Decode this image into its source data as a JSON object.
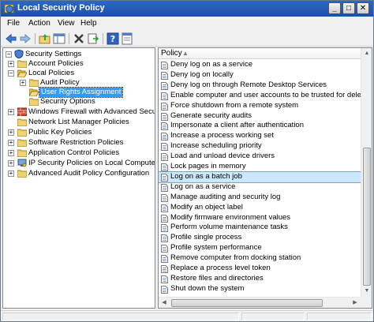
{
  "window": {
    "title": "Local Security Policy"
  },
  "menu": [
    "File",
    "Action",
    "View",
    "Help"
  ],
  "window_buttons": {
    "minimize": "_",
    "maximize": "□",
    "close": "✕"
  },
  "tree": [
    {
      "label": "Security Settings",
      "icon": "shield-icon",
      "level": 0,
      "expander": "−"
    },
    {
      "label": "Account Policies",
      "icon": "folder-icon",
      "level": 1,
      "expander": "+"
    },
    {
      "label": "Local Policies",
      "icon": "folder-open-icon",
      "level": 1,
      "expander": "−"
    },
    {
      "label": "Audit Policy",
      "icon": "folder-icon",
      "level": 2,
      "expander": "+"
    },
    {
      "label": "User Rights Assignment",
      "icon": "folder-open-icon",
      "level": 2,
      "expander": "",
      "selected": true
    },
    {
      "label": "Security Options",
      "icon": "folder-icon",
      "level": 2,
      "expander": ""
    },
    {
      "label": "Windows Firewall with Advanced Security",
      "icon": "firewall-icon",
      "level": 1,
      "expander": "+"
    },
    {
      "label": "Network List Manager Policies",
      "icon": "folder-icon",
      "level": 1,
      "expander": ""
    },
    {
      "label": "Public Key Policies",
      "icon": "folder-icon",
      "level": 1,
      "expander": "+"
    },
    {
      "label": "Software Restriction Policies",
      "icon": "folder-icon",
      "level": 1,
      "expander": "+"
    },
    {
      "label": "Application Control Policies",
      "icon": "folder-icon",
      "level": 1,
      "expander": "+"
    },
    {
      "label": "IP Security Policies on Local Computer",
      "icon": "ipsec-icon",
      "level": 1,
      "expander": "+"
    },
    {
      "label": "Advanced Audit Policy Configuration",
      "icon": "folder-icon",
      "level": 1,
      "expander": "+"
    }
  ],
  "list_header": {
    "column": "Policy",
    "sort_arrow": "▲"
  },
  "policies": [
    {
      "label": "Deny log on as a service"
    },
    {
      "label": "Deny log on locally"
    },
    {
      "label": "Deny log on through Remote Desktop Services"
    },
    {
      "label": "Enable computer and user accounts to be trusted for delegation"
    },
    {
      "label": "Force shutdown from a remote system"
    },
    {
      "label": "Generate security audits"
    },
    {
      "label": "Impersonate a client after authentication"
    },
    {
      "label": "Increase a process working set"
    },
    {
      "label": "Increase scheduling priority"
    },
    {
      "label": "Load and unload device drivers"
    },
    {
      "label": "Lock pages in memory"
    },
    {
      "label": "Log on as a batch job",
      "selected": true
    },
    {
      "label": "Log on as a service"
    },
    {
      "label": "Manage auditing and security log"
    },
    {
      "label": "Modify an object label"
    },
    {
      "label": "Modify firmware environment values"
    },
    {
      "label": "Perform volume maintenance tasks"
    },
    {
      "label": "Profile single process"
    },
    {
      "label": "Profile system performance"
    },
    {
      "label": "Remove computer from docking station"
    },
    {
      "label": "Replace a process level token"
    },
    {
      "label": "Restore files and directories"
    },
    {
      "label": "Shut down the system"
    }
  ],
  "colors": {
    "selection": "#3399ff",
    "list_selection": "#cce8ff",
    "titlebar": "#1c4fa6"
  }
}
